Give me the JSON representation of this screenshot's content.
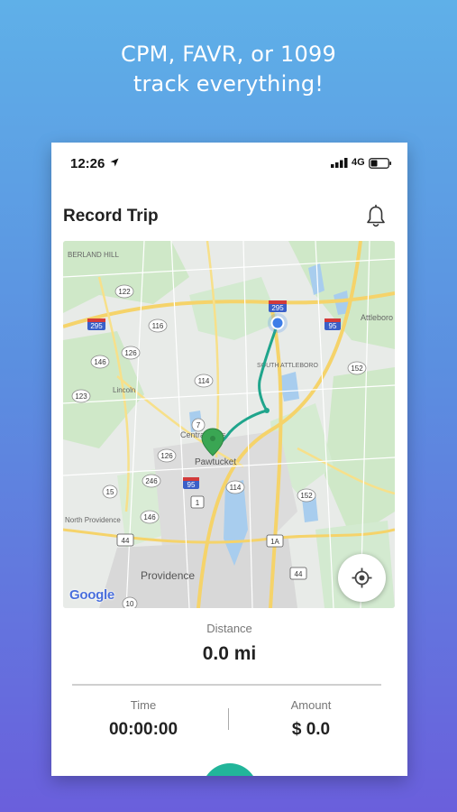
{
  "promo": {
    "line1": "CPM, FAVR, or 1099",
    "line2": "track everything!"
  },
  "status_bar": {
    "time": "12:26",
    "network": "4G",
    "icons": [
      "location-arrow-icon",
      "signal-bars-icon",
      "battery-icon"
    ]
  },
  "header": {
    "title": "Record Trip",
    "icon": "bell-icon"
  },
  "map": {
    "place_labels": [
      "BERLAND HILL",
      "Pawtucket",
      "Central Falls",
      "Providence",
      "SOUTH ATTLEBORO",
      "Attleboro",
      "Lincoln",
      "North Providence"
    ],
    "route_shields": [
      "122",
      "295",
      "116",
      "126",
      "146",
      "123",
      "114",
      "7",
      "126",
      "246",
      "95",
      "15",
      "1",
      "146",
      "114",
      "152",
      "1A",
      "44",
      "44",
      "10",
      "152",
      "295",
      "95"
    ],
    "attribution": "Google",
    "locate_button_icon": "crosshair-locate-icon",
    "start_marker": "blue-dot-icon",
    "end_marker": "green-pin-icon",
    "route_color": "#1fa58c"
  },
  "trip": {
    "distance_label": "Distance",
    "distance_value": "0.0 mi",
    "time_label": "Time",
    "time_value": "00:00:00",
    "amount_label": "Amount",
    "amount_value": "$ 0.0"
  },
  "colors": {
    "accent": "#22b59a",
    "background_top": "#5fb0e8",
    "background_bottom": "#6a5fdc"
  }
}
